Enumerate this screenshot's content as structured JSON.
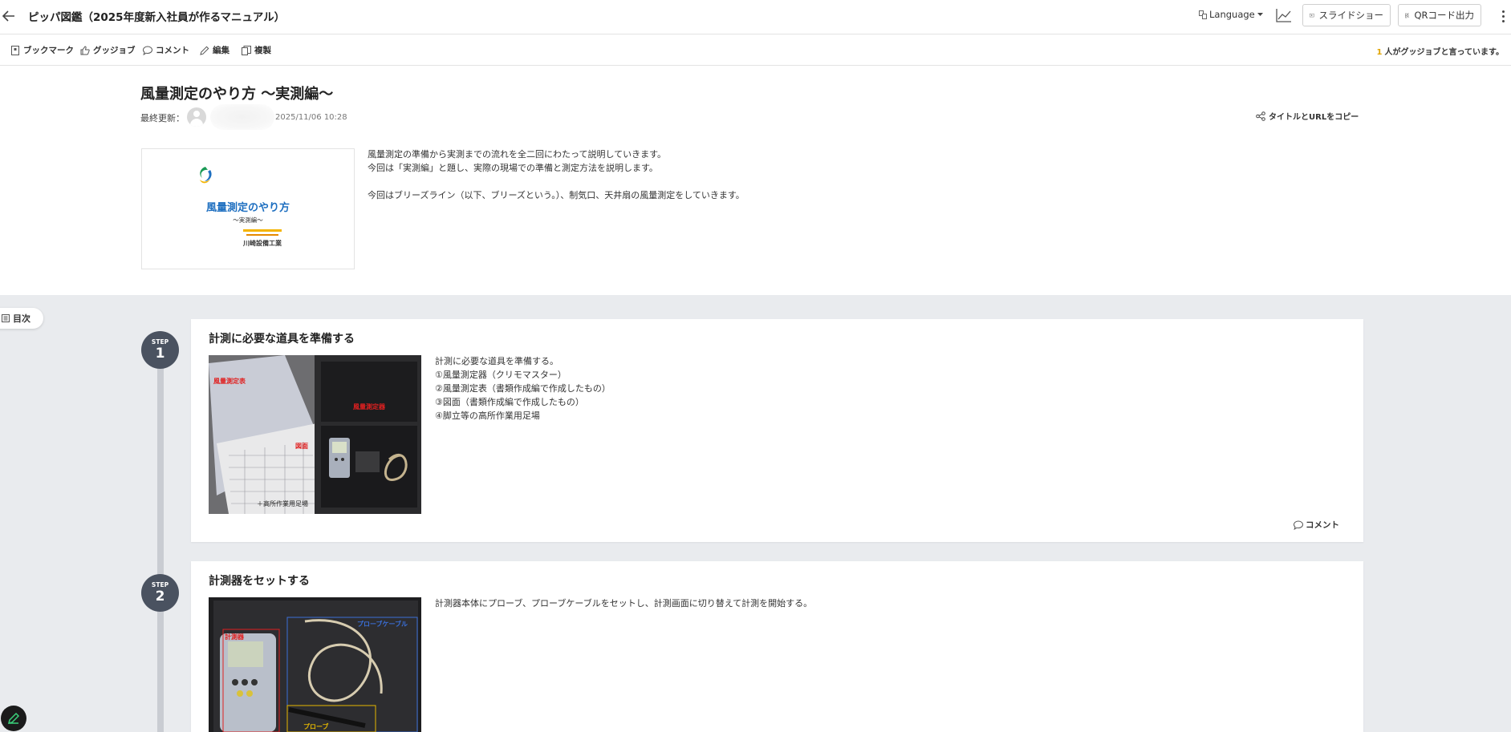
{
  "header": {
    "app_title": "ピッパ図鑑（2025年度新入社員が作るマニュアル）",
    "language_label": "Language",
    "slideshow_label": "スライドショー",
    "qr_label": "QRコード出力"
  },
  "actions": {
    "bookmark": "ブックマーク",
    "gujjob": "グッジョブ",
    "comment": "コメント",
    "edit": "編集",
    "duplicate": "複製",
    "gujjob_count": "1",
    "gujjob_suffix": "人がグッジョブと言っています。"
  },
  "doc": {
    "title": "風量測定のやり方 ～実測編～",
    "updated_label": "最終更新：",
    "updated_date": "2025/11/06 10:28",
    "copy_label": "タイトルとURLをコピー",
    "cover": {
      "main": "風量測定のやり方",
      "sub": "～実測編～",
      "company": "川崎設備工業"
    },
    "intro": [
      "風量測定の準備から実測までの流れを全二回にわたって説明していきます。",
      "今回は「実測編」と題し、実際の現場での準備と測定方法を説明します。",
      "",
      "今回はブリーズライン（以下、ブリーズという。）、制気口、天井扇の風量測定をしていきます。"
    ]
  },
  "toc_label": "目次",
  "steps": [
    {
      "label": "STEP",
      "number": "1",
      "title": "計測に必要な道具を準備する",
      "image_labels": [
        "風量測定表",
        "風量測定器",
        "図面",
        "＋高所作業用足場"
      ],
      "text": [
        "計測に必要な道具を準備する。",
        "①風量測定器（クリモマスター）",
        "②風量測定表（書類作成編で作成したもの）",
        "③図面（書類作成編で作成したもの）",
        "④脚立等の高所作業用足場"
      ],
      "comment_label": "コメント"
    },
    {
      "label": "STEP",
      "number": "2",
      "title": "計測器をセットする",
      "image_labels": [
        "計測器",
        "プローブケーブル",
        "プローブ"
      ],
      "text": [
        "計測器本体にプローブ、プローブケーブルをセットし、計測画面に切り替えて計測を開始する。"
      ]
    }
  ],
  "colors": {
    "step_badge": "#4a5260",
    "steps_background": "#e9ebee",
    "gujjob_count": "#e0a400",
    "cover_title": "#1e6fc0"
  }
}
